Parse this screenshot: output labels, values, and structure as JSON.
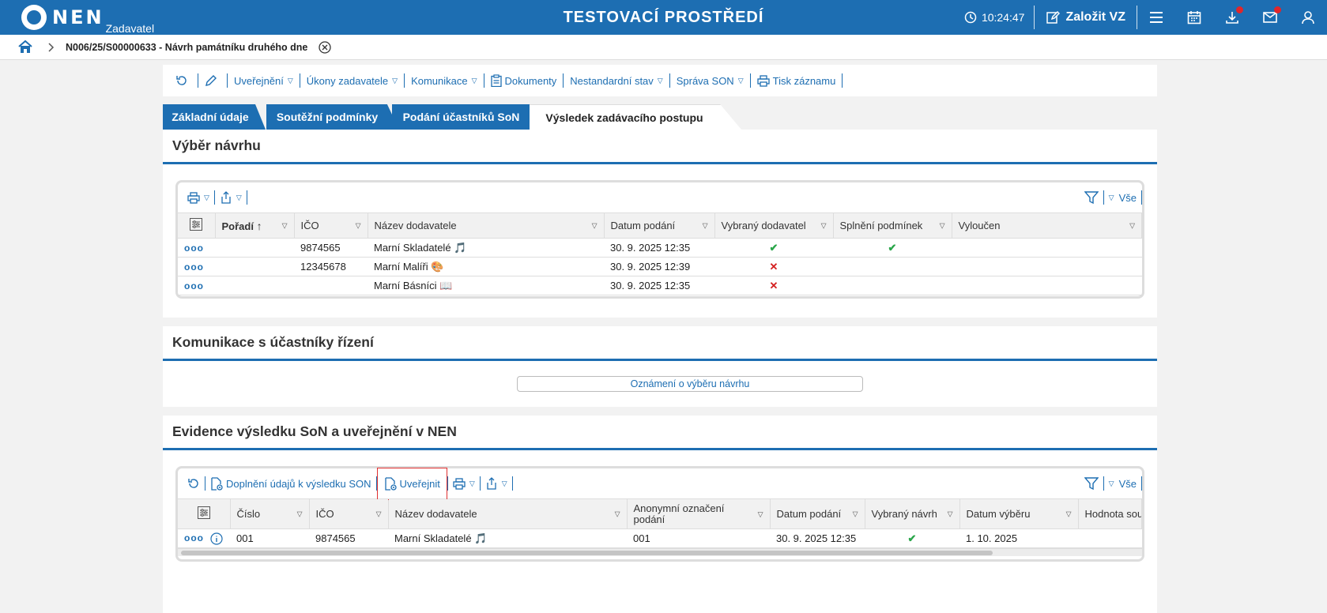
{
  "header": {
    "logo_text": "NEN",
    "logo_sub": "Zadavatel",
    "env_title": "TESTOVACÍ PROSTŘEDÍ",
    "time": "10:24:47",
    "create_label": "Založit VZ"
  },
  "breadcrumb": {
    "title": "N006/25/S00000633 - Návrh památníku druhého dne"
  },
  "actions": {
    "uverejneni": "Uveřejnění",
    "ukony": "Úkony zadavatele",
    "komunikace": "Komunikace",
    "dokumenty": "Dokumenty",
    "nestandardni": "Nestandardní stav",
    "sprava": "Správa SON",
    "tisk": "Tisk záznamu"
  },
  "tabs": {
    "t1": "Základní údaje",
    "t2": "Soutěžní podmínky",
    "t3": "Podání účastníků SoN",
    "t4": "Výsledek zadávacího postupu"
  },
  "vyber": {
    "title": "Výběr návrhu",
    "all_label": "Vše",
    "columns": [
      "Pořadí",
      "IČO",
      "Název dodavatele",
      "Datum podání",
      "Vybraný dodavatel",
      "Splnění podmínek",
      "Vyloučen"
    ],
    "rows": [
      {
        "ico": "9874565",
        "name": "Marní Skladatelé",
        "emoji": "🎵",
        "date": "30. 9. 2025 12:35"
      },
      {
        "ico": "12345678",
        "name": "Marní Malíři",
        "emoji": "🎨",
        "date": "30. 9. 2025 12:39"
      },
      {
        "ico": "",
        "name": "Marní Básníci",
        "emoji": "📖",
        "date": "30. 9. 2025 12:35"
      }
    ]
  },
  "komunikace": {
    "title": "Komunikace s účastníky řízení",
    "button": "Oznámení o výběru návrhu"
  },
  "evidence": {
    "title": "Evidence výsledku SoN a uveřejnění v NEN",
    "doplneni": "Doplnění údajů k výsledku SON",
    "uverejnit": "Uveřejnit",
    "all_label": "Vše",
    "columns": [
      "Číslo",
      "IČO",
      "Název dodavatele",
      "Anonymní označení podání",
      "Datum podání",
      "Vybraný návrh",
      "Datum výběru",
      "Hodnota sout"
    ],
    "row": {
      "cislo": "001",
      "ico": "9874565",
      "name": "Marní Skladatelé",
      "emoji": "🎵",
      "anon": "001",
      "date": "30. 9. 2025 12:35",
      "vyber_date": "1. 10. 2025"
    }
  },
  "colors": {
    "brand_blue": "#1d6eb2",
    "check_green": "#2aa64a",
    "cross_red": "#d42020",
    "highlight_red": "#e03030"
  }
}
